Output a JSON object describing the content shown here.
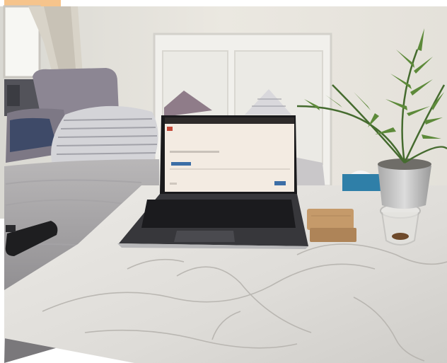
{
  "colors": {
    "corner_accent": "#f6c48c",
    "wall": "#e9e6df",
    "marble": "#e2e0dd",
    "laptop_screen": "#f3ebe2",
    "browser_tab_bar": "#2e2b2a"
  }
}
